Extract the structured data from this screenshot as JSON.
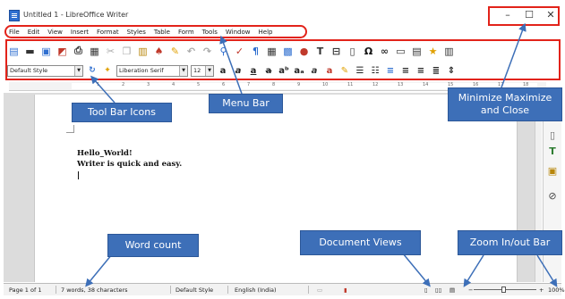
{
  "window": {
    "title": "Untitled 1 - LibreOffice Writer",
    "minimize_glyph": "–",
    "maximize_glyph": "☐",
    "close_glyph": "✕"
  },
  "menu": {
    "items": [
      "File",
      "Edit",
      "View",
      "Insert",
      "Format",
      "Styles",
      "Table",
      "Form",
      "Tools",
      "Window",
      "Help"
    ]
  },
  "format_bar": {
    "paragraph_style": "Default Style",
    "font_name": "Liberation Serif",
    "font_size": "12"
  },
  "document": {
    "lines": [
      "Hello_World!",
      "Writer is quick and easy."
    ]
  },
  "statusbar": {
    "page": "Page 1 of 1",
    "word_count": "7 words, 38 characters",
    "page_style": "Default Style",
    "language": "English (India)",
    "zoom": "100%"
  },
  "callouts": {
    "toolbar_icons": "Tool Bar Icons",
    "menu_bar": "Menu Bar",
    "window_controls_line1": "Minimize Maximize",
    "window_controls_line2": "and Close",
    "word_count": "Word count",
    "document_views": "Document Views",
    "zoom_bar": "Zoom In/out Bar"
  },
  "colors": {
    "highlight": "#e2231a",
    "callout_bg": "#3d6fb8",
    "app_icon": "#2f6fd0"
  }
}
